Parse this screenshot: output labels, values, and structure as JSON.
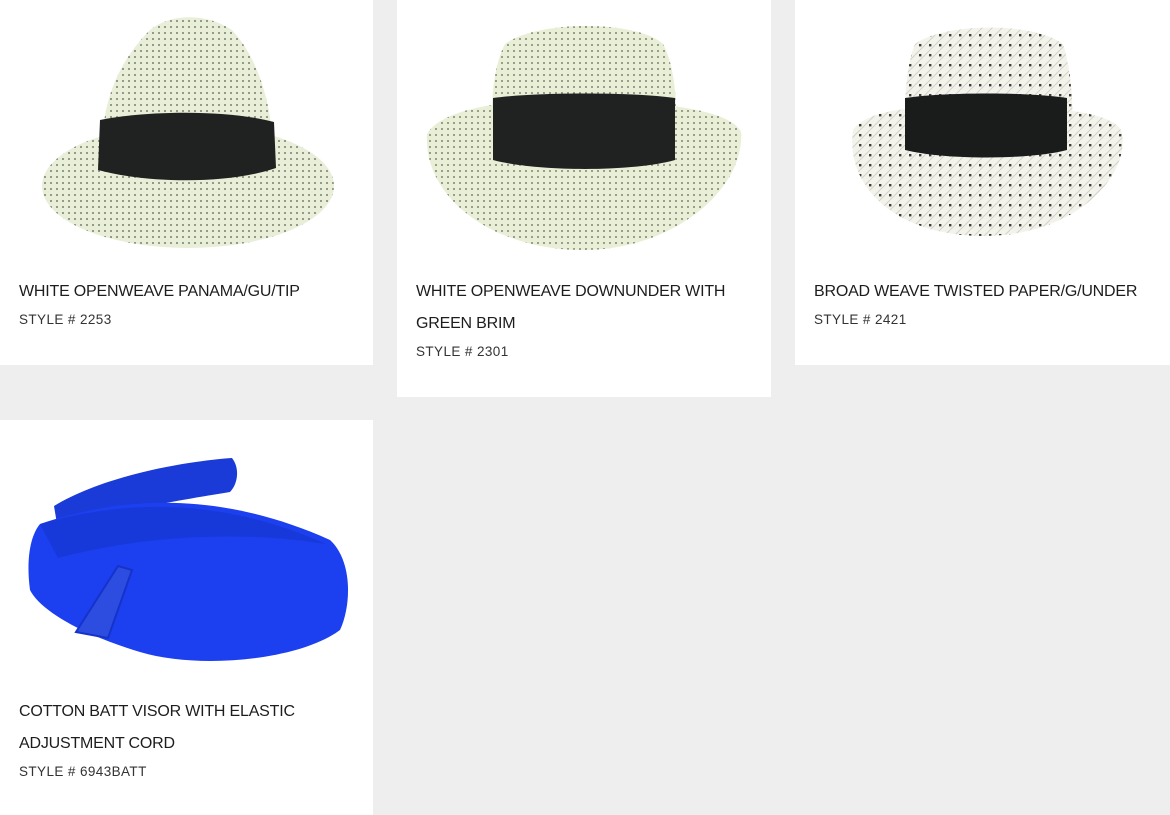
{
  "products": [
    {
      "title": "WHITE OPENWEAVE PANAMA/GU/TIP",
      "style_prefix": "STYLE #",
      "style_number": "2253",
      "image": "white-openweave-panama-hat",
      "colors": {
        "straw": "#e8eed8",
        "band": "#1f2220",
        "trim": "#ffffff"
      }
    },
    {
      "title": "WHITE OPENWEAVE DOWNUNDER WITH GREEN BRIM",
      "style_prefix": "STYLE #",
      "style_number": "2301",
      "image": "white-openweave-downunder-hat",
      "colors": {
        "straw": "#e9efd6",
        "band": "#1f2220",
        "trim": "#ffffff"
      }
    },
    {
      "title": "BROAD WEAVE TWISTED PAPER/G/UNDER",
      "style_prefix": "STYLE #",
      "style_number": "2421",
      "image": "broad-weave-twisted-paper-hat",
      "colors": {
        "straw": "#f3f3ec",
        "band": "#1a1c1b",
        "trim": "#ffffff"
      }
    },
    {
      "title": "COTTON BATT VISOR WITH ELASTIC ADJUSTMENT CORD",
      "style_prefix": "STYLE #",
      "style_number": "6943BATT",
      "image": "blue-cotton-visor",
      "colors": {
        "fabric": "#1c3ff0",
        "shadow": "#1233c4",
        "logo": "#2d4de0"
      }
    }
  ]
}
